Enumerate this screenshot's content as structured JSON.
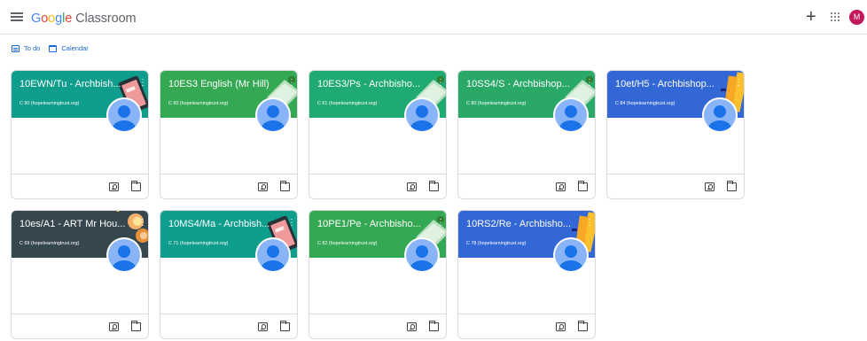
{
  "app": {
    "brand_google": [
      "G",
      "o",
      "o",
      "g",
      "l",
      "e"
    ],
    "brand_product": "Classroom",
    "add_label": "+",
    "account_initial": "M"
  },
  "subnav": {
    "todo": "To do",
    "calendar": "Calendar"
  },
  "colors": {
    "teal": "#129eaf",
    "green": "#1e8e3e",
    "blue": "#1967d2",
    "dark": "#37474f"
  },
  "classes": [
    {
      "title": "10EWN/Tu - Archbish...",
      "section": "C 90 (hopelearningtrust.org)",
      "color": "#0f9d8c",
      "art": "tablet"
    },
    {
      "title": "10ES3 English (Mr Hill)",
      "section": "C 60 (hopelearningtrust.org)",
      "color": "#34a853",
      "art": "book"
    },
    {
      "title": "10ES3/Ps - Archbisho...",
      "section": "C 61 (hopelearningtrust.org)",
      "color": "#1faa72",
      "art": "book"
    },
    {
      "title": "10SS4/S - Archbishop...",
      "section": "C 80 (hopelearningtrust.org)",
      "color": "#2aa868",
      "art": "book"
    },
    {
      "title": "10et/H5 - Archbishop...",
      "section": "C 84 (hopelearningtrust.org)",
      "color": "#3367d6",
      "art": "books"
    },
    {
      "title": "10es/A1 - ART Mr Hou...",
      "section": "C 69 (hopelearningtrust.org)",
      "color": "#37474f",
      "art": "paint"
    },
    {
      "title": "10MS4/Ma - Archbish...",
      "section": "C 71 (hopelearningtrust.org)",
      "color": "#0f9d8c",
      "art": "tablet"
    },
    {
      "title": "10PE1/Pe - Archbisho...",
      "section": "C 82 (hopelearningtrust.org)",
      "color": "#34a853",
      "art": "book"
    },
    {
      "title": "10RS2/Re - Archbisho...",
      "section": "C 78 (hopelearningtrust.org)",
      "color": "#3367d6",
      "art": "books"
    }
  ],
  "icons": {
    "menu": "hamburger-menu-icon",
    "apps": "apps-grid-icon",
    "todo": "assignment-list-icon",
    "calendar": "calendar-icon",
    "work": "assignment-ind-icon",
    "folder": "folder-icon",
    "more": "more-vert-icon"
  }
}
